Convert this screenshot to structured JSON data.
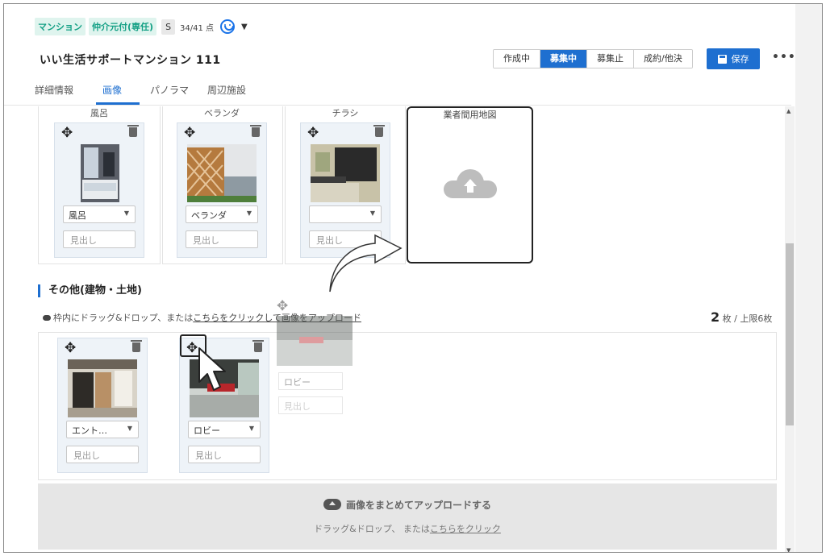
{
  "header": {
    "tags": [
      "マンション",
      "仲介元付(専任)"
    ],
    "rank_badge": "S",
    "score": "34/41 点",
    "smile_icon": "smile-icon",
    "dropdown_icon": "chevron-down-icon",
    "title": "いい生活サポートマンション 111",
    "statuses": [
      {
        "label": "作成中",
        "active": false
      },
      {
        "label": "募集中",
        "active": true
      },
      {
        "label": "募集止",
        "active": false
      },
      {
        "label": "成約/他決",
        "active": false
      }
    ],
    "save_label": "保存",
    "more_label": "•••"
  },
  "tabs": [
    {
      "label": "詳細情報",
      "active": false
    },
    {
      "label": "画像",
      "active": true
    },
    {
      "label": "パノラマ",
      "active": false
    },
    {
      "label": "周辺施設",
      "active": false
    }
  ],
  "room_cards": [
    {
      "category_label": "風呂",
      "select_value": "風呂",
      "heading_placeholder": "見出し"
    },
    {
      "category_label": "ベランダ",
      "select_value": "ベランダ",
      "heading_placeholder": "見出し"
    },
    {
      "category_label": "チラシ",
      "select_value": "",
      "heading_placeholder": "見出し"
    }
  ],
  "upload_slot": {
    "label": "業者間用地図",
    "icon": "cloud-upload-icon"
  },
  "other_section": {
    "title": "その他(建物・土地)",
    "hint_prefix": "枠内にドラッグ&ドロップ、または",
    "hint_link": "こちらをクリックして画像をアップロード",
    "count": "2",
    "count_suffix": "枚 / 上限6枚",
    "cards": [
      {
        "select_value": "エント…",
        "heading_placeholder": "見出し"
      },
      {
        "select_value": "ロビー",
        "heading_placeholder": "見出し"
      }
    ],
    "ghost_card": {
      "select_value": "ロビー",
      "heading_placeholder": "見出し"
    }
  },
  "bulk_upload": {
    "main_label": "画像をまとめてアップロードする",
    "sub_prefix": "ドラッグ&ドロップ、 または",
    "sub_link": "こちらをクリック"
  }
}
